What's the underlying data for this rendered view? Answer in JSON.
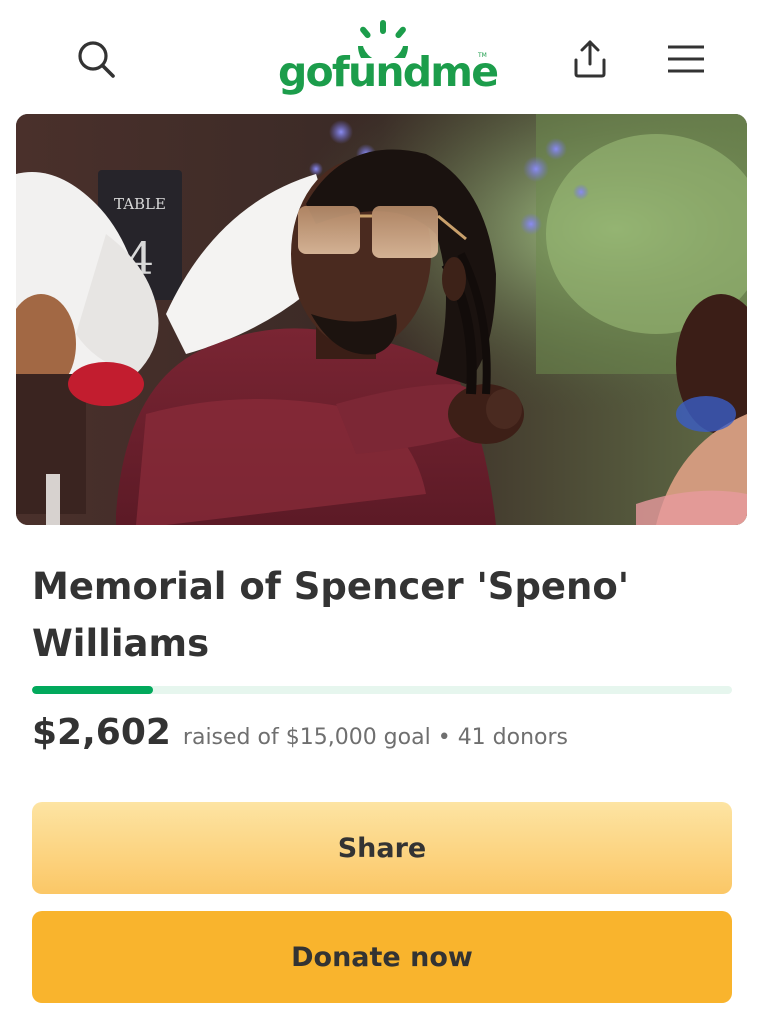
{
  "header": {
    "logo_text": "gofundme",
    "logo_tm": "TM",
    "icons": {
      "search": "search-icon",
      "share": "share-upload-icon",
      "menu": "hamburger-menu-icon"
    },
    "brand_color": "#1c9d4b"
  },
  "campaign": {
    "title": "Memorial of Spencer 'Speno' Williams",
    "amount_raised": "$2,602",
    "goal_text": "raised of $15,000 goal",
    "bullet": "•",
    "donors_text": "41 donors",
    "progress_fraction": 0.173,
    "progress_color": "#02a95c",
    "progress_track_color": "#e6f6ee"
  },
  "hero": {
    "table_sign_line1": "TABLE",
    "table_sign_line2": "4"
  },
  "buttons": {
    "share_label": "Share",
    "donate_label": "Donate now",
    "donate_color": "#f9b42d"
  }
}
